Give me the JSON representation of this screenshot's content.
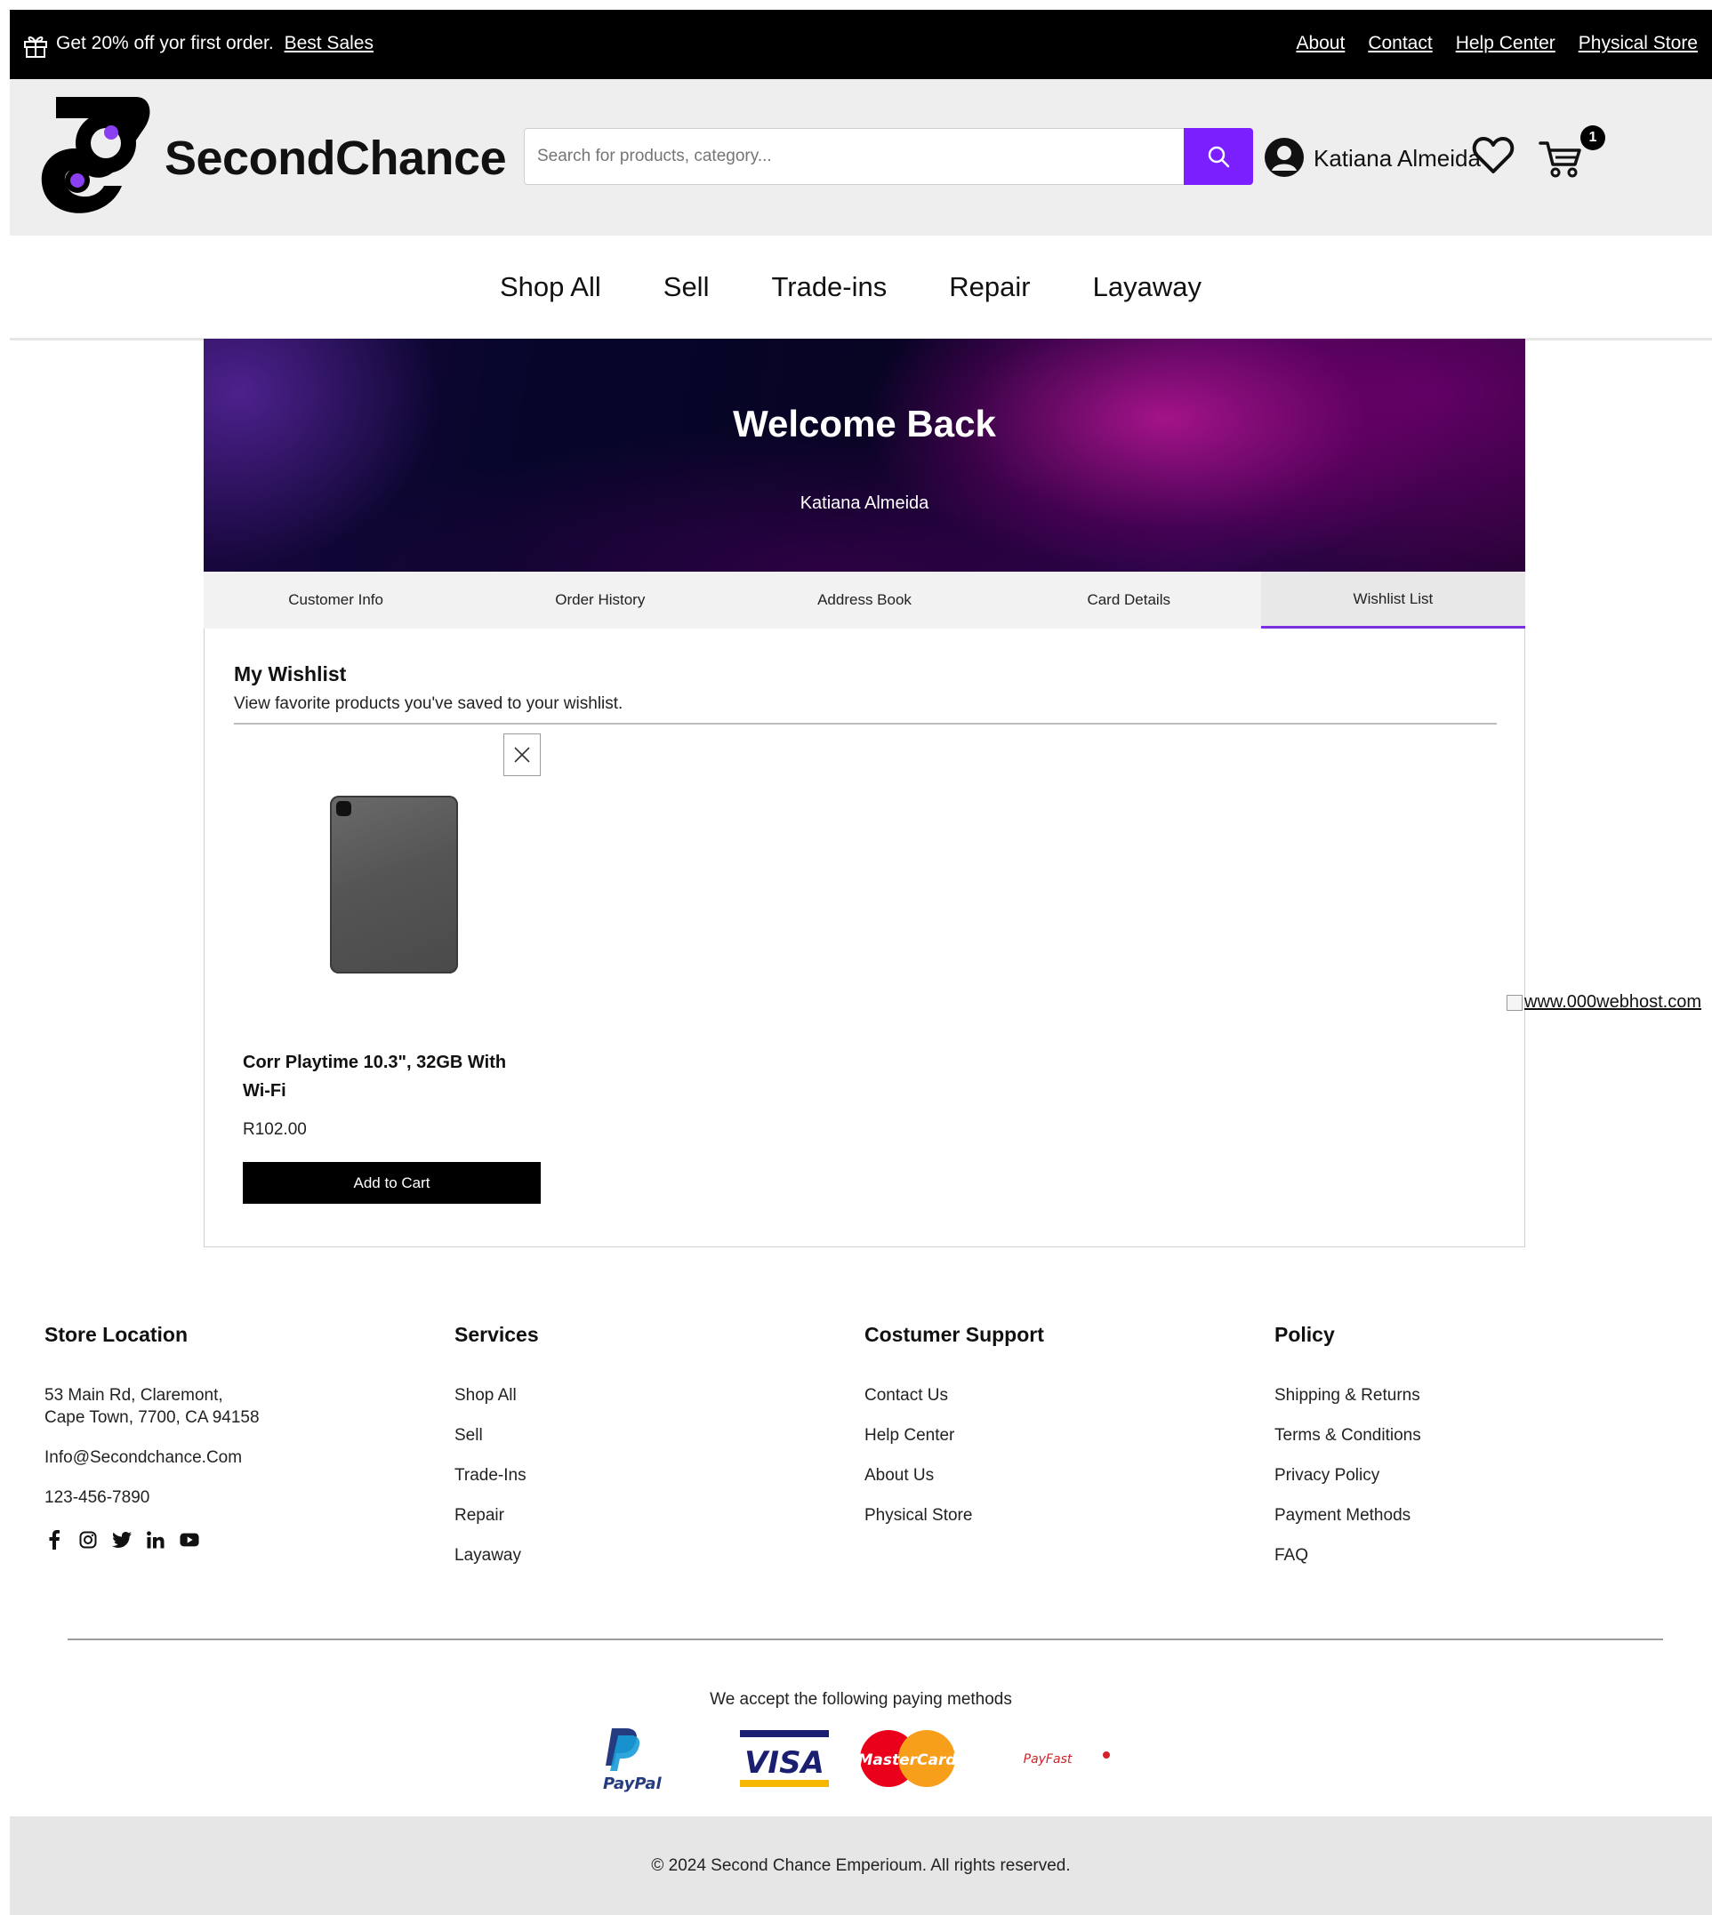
{
  "promo": {
    "text": "Get 20% off yor first order.",
    "link": "Best Sales",
    "top_links": [
      "About",
      "Contact",
      "Help Center",
      "Physical Store"
    ]
  },
  "header": {
    "brand": "SecondChance",
    "search_placeholder": "Search for products, category...",
    "user_name": "Katiana Almeida",
    "cart_count": "1",
    "accent_color": "#7b1fff"
  },
  "nav": {
    "items": [
      "Shop All",
      "Sell",
      "Trade-ins",
      "Repair",
      "Layaway"
    ]
  },
  "hero": {
    "title": "Welcome Back",
    "subtitle": "Katiana Almeida"
  },
  "tabs": {
    "items": [
      "Customer Info",
      "Order History",
      "Address Book",
      "Card Details",
      "Wishlist List"
    ],
    "active": "Wishlist List"
  },
  "wishlist": {
    "title": "My Wishlist",
    "description": "View favorite products you've saved to your wishlist.",
    "items": [
      {
        "name": "Corr Playtime 10.3\", 32GB With Wi-Fi",
        "price": "R102.00",
        "button": "Add to Cart"
      }
    ]
  },
  "broken_image_alt": "www.000webhost.com",
  "footer": {
    "store": {
      "title": "Store Location",
      "address_line1": "53 Main Rd, Claremont,",
      "address_line2": "Cape Town, 7700, CA 94158",
      "email": "Info@Secondchance.Com",
      "phone": "123-456-7890"
    },
    "services": {
      "title": "Services",
      "items": [
        "Shop All",
        "Sell",
        "Trade-Ins",
        "Repair",
        "Layaway"
      ]
    },
    "support": {
      "title": "Costumer Support",
      "items": [
        "Contact Us",
        "Help Center",
        "About Us",
        "Physical Store"
      ]
    },
    "policy": {
      "title": "Policy",
      "items": [
        "Shipping & Returns",
        "Terms & Conditions",
        "Privacy Policy",
        "Payment Methods",
        "FAQ"
      ]
    },
    "social_icons": [
      "facebook-icon",
      "instagram-icon",
      "twitter-icon",
      "linkedin-icon",
      "youtube-icon"
    ],
    "payment_title": "We accept the following paying methods",
    "payment_methods": [
      "PayPal",
      "VISA",
      "MasterCard",
      "PayFast"
    ],
    "copyright": "© 2024 Second Chance Emperioum. All rights reserved."
  }
}
